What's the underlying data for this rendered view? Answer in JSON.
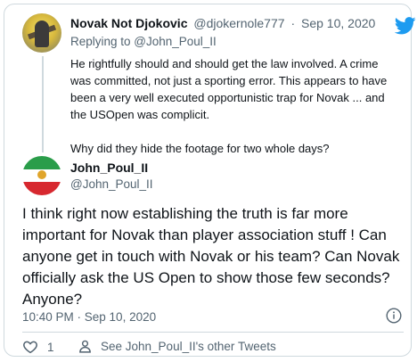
{
  "parent_tweet": {
    "display_name": "Novak Not Djokovic",
    "handle": "@djokernole777",
    "separator": "·",
    "date": "Sep 10, 2020",
    "replying_to": "Replying to @John_Poul_II",
    "paragraph_1": "He rightfully should and should get the law involved. A crime was committed, not just a sporting error. This appears to have been a very well executed opportunistic trap for Novak ... and the USOpen was complicit.",
    "paragraph_2": "Why did they hide the footage for two whole days?"
  },
  "main_tweet": {
    "display_name": "John_Poul_II",
    "handle": "@John_Poul_II",
    "text": "I think right now establishing the truth is far more important for Novak than player association stuff ! Can anyone get in touch with Novak or his team? Can Novak officially ask the US Open to show those few seconds? Anyone?",
    "timestamp": "10:40 PM · Sep 10, 2020"
  },
  "actions": {
    "like_count": "1",
    "see_more_label": "See John_Poul_II's other Tweets"
  },
  "colors": {
    "brand": "#1d9bf0",
    "secondary_text": "#536471",
    "border": "#cfd9de"
  },
  "icons": {
    "logo": "twitter-bird-icon",
    "info": "info-icon",
    "like": "heart-icon",
    "profile": "person-icon"
  }
}
